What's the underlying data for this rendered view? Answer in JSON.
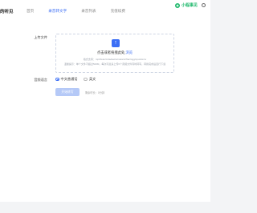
{
  "header": {
    "brand_partial": "的听见",
    "nav": [
      "首页",
      "录音转文字",
      "录音列表",
      "充值续费"
    ],
    "active_index": 1,
    "logo_text": "小程事见"
  },
  "upload": {
    "label": "上传文件",
    "title_prefix": "点击或者拖拽此处,",
    "title_link": "浏览",
    "desc1": "格式支持：mp3/wav/m4a/aac/wma/amr/flac/ogg/opus/wmv",
    "desc2": "温馨提示：单个文件不超过500M，每次可最多上传6个音频文件同时转写，转换完成后自行下载"
  },
  "language": {
    "label": "音频语言",
    "options": [
      "中文普通话",
      "英文"
    ],
    "selected_index": 0
  },
  "actions": {
    "submit_label": "开始转写",
    "balance_text": "剩余时长：0分钟"
  },
  "colors": {
    "accent": "#3b6ef5",
    "brand": "#1db86b"
  }
}
